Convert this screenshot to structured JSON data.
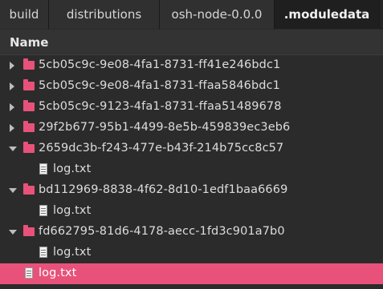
{
  "tabs": [
    {
      "label": "build"
    },
    {
      "label": "distributions"
    },
    {
      "label": "osh-node-0.0.0"
    },
    {
      "label": ".moduledata"
    }
  ],
  "column_header": "Name",
  "tree": [
    {
      "label": "5cb05c9c-9e08-4fa1-8731-ff41e246bdc1",
      "type": "folder",
      "state": "collapsed"
    },
    {
      "label": "5cb05c9c-9e08-4fa1-8731-ffaa5846bdc1",
      "type": "folder",
      "state": "collapsed"
    },
    {
      "label": "5cb05c9c-9123-4fa1-8731-ffaa51489678",
      "type": "folder",
      "state": "collapsed"
    },
    {
      "label": "29f2b677-95b1-4499-8e5b-459839ec3eb6",
      "type": "folder",
      "state": "collapsed"
    },
    {
      "label": "2659dc3b-f243-477e-b43f-214b75cc8c57",
      "type": "folder",
      "state": "expanded"
    },
    {
      "label": "log.txt",
      "type": "file"
    },
    {
      "label": "bd112969-8838-4f62-8d10-1edf1baa6669",
      "type": "folder",
      "state": "expanded"
    },
    {
      "label": "log.txt",
      "type": "file"
    },
    {
      "label": "fd662795-81d6-4178-aecc-1fd3c901a7b0",
      "type": "folder",
      "state": "expanded"
    },
    {
      "label": "log.txt",
      "type": "file"
    },
    {
      "label": "log.txt",
      "type": "file",
      "selected": true
    }
  ],
  "colors": {
    "accent": "#e8527a",
    "background": "#2b2b2b"
  },
  "icons": {
    "folder": "folder-icon",
    "file": "text-file-icon",
    "collapsed": "chevron-right-icon",
    "expanded": "chevron-down-icon"
  }
}
